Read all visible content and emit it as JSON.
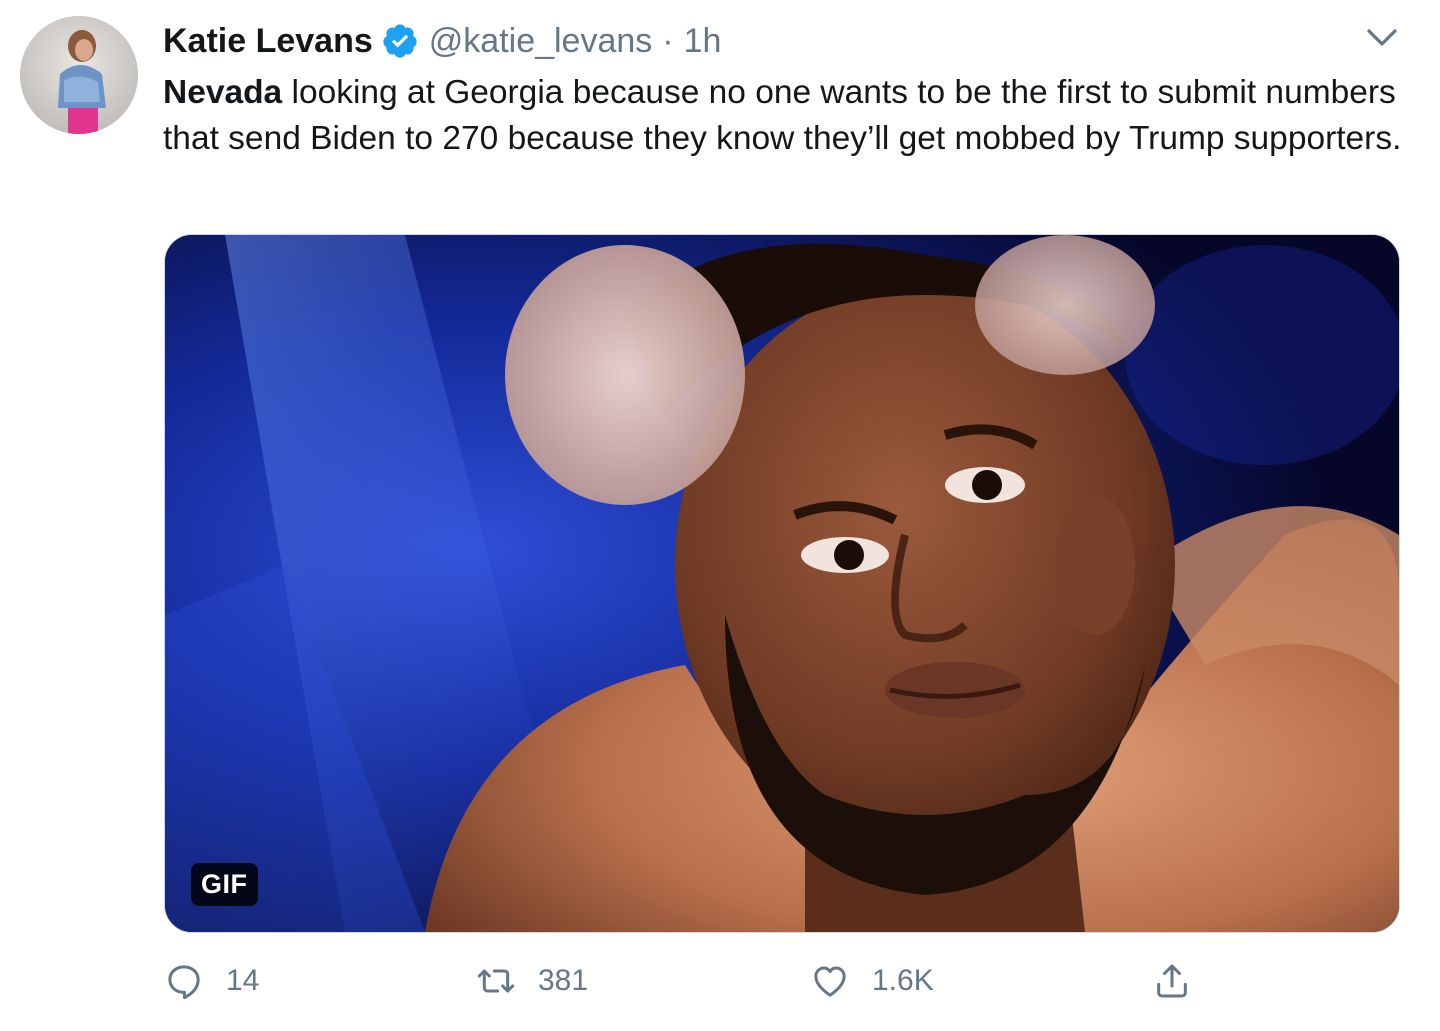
{
  "tweet": {
    "author": {
      "display_name": "Katie Levans",
      "handle": "@katie_levans",
      "verified": true
    },
    "separator": "·",
    "time": "1h",
    "text_bold": "Nevada",
    "text_rest": " looking at Georgia because no one wants to be the first to submit numbers that send Biden to 270 because they know they’ll get mobbed by Trump supporters.",
    "media_badge": "GIF",
    "actions": {
      "reply_count": "14",
      "retweet_count": "381",
      "like_count": "1.6K"
    }
  },
  "icons": {
    "verified": "verified-badge-icon",
    "caret": "chevron-down-icon",
    "reply": "reply-icon",
    "retweet": "retweet-icon",
    "like": "heart-icon",
    "share": "share-icon"
  },
  "colors": {
    "verified_blue": "#1da1f2",
    "secondary_text": "#657786",
    "primary_text": "#14171a"
  }
}
